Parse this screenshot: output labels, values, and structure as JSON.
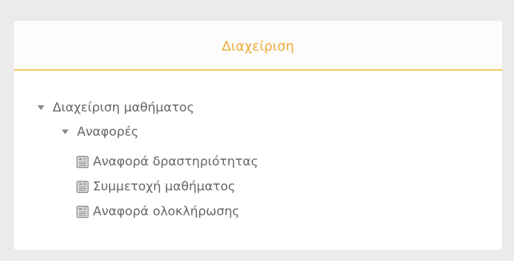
{
  "block": {
    "title": "Διαχείριση"
  },
  "tree": {
    "course_admin": {
      "label": "Διαχείριση μαθήματος",
      "expanded": true
    },
    "reports": {
      "label": "Αναφορές",
      "expanded": true
    },
    "items": [
      {
        "label": "Αναφορά δραστηριότητας",
        "icon": "report-icon"
      },
      {
        "label": "Συμμετοχή μαθήματος",
        "icon": "report-icon"
      },
      {
        "label": "Αναφορά ολοκλήρωσης",
        "icon": "report-icon"
      }
    ]
  },
  "colors": {
    "title": "#f0a932",
    "header_rule": "#f0c550",
    "text": "#666666",
    "background": "#ebebeb"
  }
}
